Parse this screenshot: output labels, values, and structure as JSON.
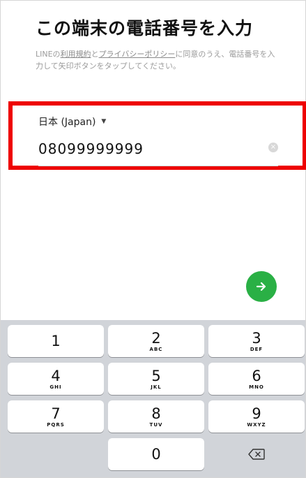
{
  "header": {
    "title": "この端末の電話番号を入力",
    "terms_prefix": "LINEの",
    "terms_link": "利用規約",
    "terms_and": "と",
    "privacy_link": "プライバシーポリシー",
    "terms_suffix": "に同意のうえ、電話番号を入力して矢印ボタンをタップしてください。"
  },
  "form": {
    "country": "日本 (Japan)",
    "phone_number": "08099999999"
  },
  "icons": {
    "dropdown": "caret-down-icon",
    "clear": "clear-icon",
    "next": "arrow-right-icon",
    "backspace": "backspace-icon"
  },
  "colors": {
    "accent_green": "#2ab045",
    "highlight_red": "#ee0000",
    "keypad_bg": "#d1d4d9"
  },
  "keypad": {
    "keys": [
      {
        "num": "1",
        "letters": ""
      },
      {
        "num": "2",
        "letters": "ABC"
      },
      {
        "num": "3",
        "letters": "DEF"
      },
      {
        "num": "4",
        "letters": "GHI"
      },
      {
        "num": "5",
        "letters": "JKL"
      },
      {
        "num": "6",
        "letters": "MNO"
      },
      {
        "num": "7",
        "letters": "PQRS"
      },
      {
        "num": "8",
        "letters": "TUV"
      },
      {
        "num": "9",
        "letters": "WXYZ"
      },
      {
        "num": "0",
        "letters": ""
      }
    ]
  }
}
